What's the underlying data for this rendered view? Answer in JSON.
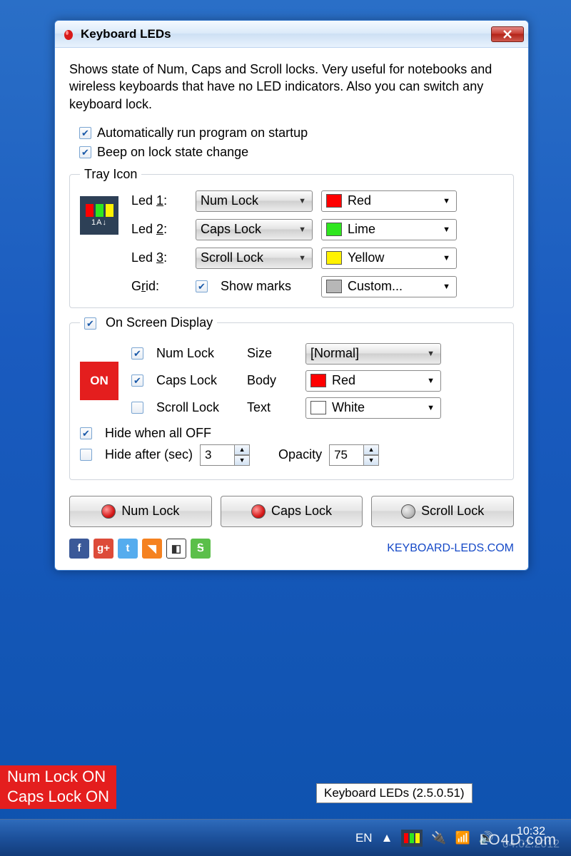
{
  "window": {
    "title": "Keyboard LEDs",
    "description": "Shows state of Num, Caps and Scroll locks. Very useful for notebooks and wireless keyboards that have no LED indicators. Also you can switch any keyboard lock.",
    "auto_run": "Automatically run program on startup",
    "beep": "Beep on lock state change"
  },
  "tray": {
    "legend": "Tray Icon",
    "leds": [
      {
        "label_pre": "Led ",
        "underline": "1",
        "label_post": ":",
        "value": "Num Lock",
        "color_name": "Red",
        "color": "#ff0000"
      },
      {
        "label_pre": "Led ",
        "underline": "2",
        "label_post": ":",
        "value": "Caps Lock",
        "color_name": "Lime",
        "color": "#2fe61f"
      },
      {
        "label_pre": "Led ",
        "underline": "3",
        "label_post": ":",
        "value": "Scroll Lock",
        "color_name": "Yellow",
        "color": "#fff200"
      }
    ],
    "grid_pre": "G",
    "grid_under": "r",
    "grid_post": "id:",
    "show_marks": "Show marks",
    "grid_color_name": "Custom...",
    "grid_color": "#b7b7b7",
    "preview_label": "1A↓"
  },
  "osd": {
    "legend": "On Screen Display",
    "on_tile": "ON",
    "locks": [
      {
        "label": "Num Lock",
        "checked": true
      },
      {
        "label": "Caps Lock",
        "checked": true
      },
      {
        "label": "Scroll Lock",
        "checked": false
      }
    ],
    "size_label": "Size",
    "size_value": "[Normal]",
    "body_label": "Body",
    "body_color_name": "Red",
    "body_color": "#ff0000",
    "text_label": "Text",
    "text_color_name": "White",
    "text_color": "#ffffff",
    "hide_all": "Hide when all OFF",
    "hide_after": "Hide after (sec)",
    "hide_after_val": "3",
    "opacity_label": "Opacity",
    "opacity_val": "75"
  },
  "buttons": {
    "num": "Num Lock",
    "caps": "Caps Lock",
    "scroll": "Scroll Lock"
  },
  "link": "KEYBOARD-LEDS.COM",
  "osd_overlay": {
    "l1": "Num Lock ON",
    "l2": "Caps Lock ON"
  },
  "tooltip": "Keyboard LEDs (2.5.0.51)",
  "taskbar": {
    "lang": "EN",
    "clock": "10:32",
    "date": "04.02.2012"
  },
  "watermark": "LO4D.com"
}
